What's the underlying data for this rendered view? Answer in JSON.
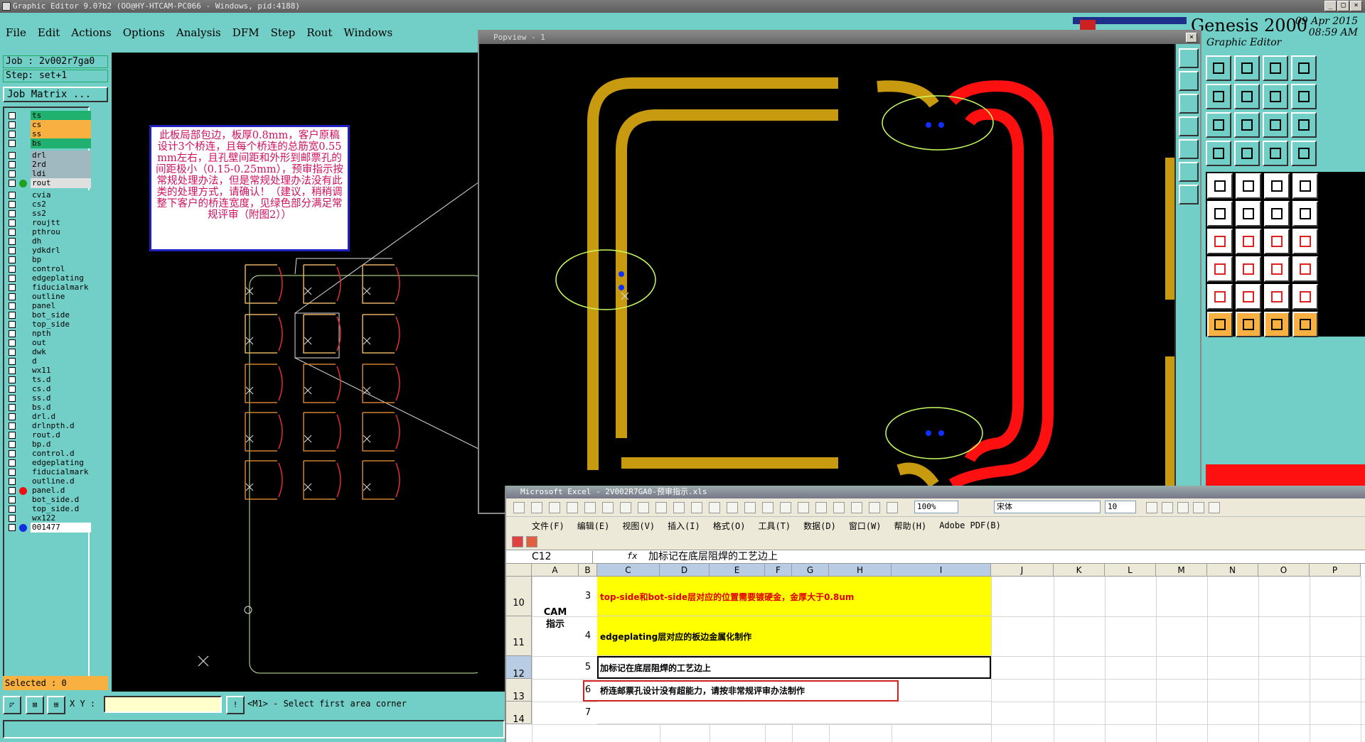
{
  "window": {
    "title": "Graphic Editor 9.0?b2 (OO@HY-HTCAM-PC066 - Windows, pid:4188)"
  },
  "menu": [
    "File",
    "Edit",
    "Actions",
    "Options",
    "Analysis",
    "DFM",
    "Step",
    "Rout",
    "Windows"
  ],
  "genesis": {
    "title": "Genesis 2000",
    "subtitle": "Graphic Editor",
    "date": "09 Apr 2015",
    "time": "08:59 AM"
  },
  "job": {
    "job_label": "Job : 2v002r7ga0",
    "step_label": "Step: set+1",
    "matrix_button": "Job Matrix ..."
  },
  "layers": [
    {
      "name": "ts",
      "color": "#20b070"
    },
    {
      "name": "cs",
      "color": "#f8b040"
    },
    {
      "name": "ss",
      "color": "#f8b040"
    },
    {
      "name": "bs",
      "color": "#20b070"
    },
    {
      "name": "drl",
      "color": "#a0b8c0"
    },
    {
      "name": "2rd",
      "color": "#a0b8c0"
    },
    {
      "name": "ldi",
      "color": "#a0b8c0"
    },
    {
      "name": "rout",
      "color": "#e0e0e0",
      "dot": "#20a020"
    },
    {
      "name": "cvia",
      "color": ""
    },
    {
      "name": "cs2",
      "color": ""
    },
    {
      "name": "ss2",
      "color": ""
    },
    {
      "name": "roujtt",
      "color": ""
    },
    {
      "name": "pthrou",
      "color": ""
    },
    {
      "name": "dh",
      "color": ""
    },
    {
      "name": "ydkdrl",
      "color": ""
    },
    {
      "name": "bp",
      "color": ""
    },
    {
      "name": "control",
      "color": ""
    },
    {
      "name": "edgeplating",
      "color": ""
    },
    {
      "name": "fiducialmark",
      "color": ""
    },
    {
      "name": "outline",
      "color": ""
    },
    {
      "name": "panel",
      "color": ""
    },
    {
      "name": "bot_side",
      "color": ""
    },
    {
      "name": "top_side",
      "color": ""
    },
    {
      "name": "npth",
      "color": ""
    },
    {
      "name": "out",
      "color": ""
    },
    {
      "name": "dwk",
      "color": ""
    },
    {
      "name": "d",
      "color": ""
    },
    {
      "name": "wx11",
      "color": ""
    },
    {
      "name": "ts.d",
      "color": ""
    },
    {
      "name": "cs.d",
      "color": ""
    },
    {
      "name": "ss.d",
      "color": ""
    },
    {
      "name": "bs.d",
      "color": ""
    },
    {
      "name": "drl.d",
      "color": ""
    },
    {
      "name": "drlnpth.d",
      "color": ""
    },
    {
      "name": "rout.d",
      "color": ""
    },
    {
      "name": "bp.d",
      "color": ""
    },
    {
      "name": "control.d",
      "color": ""
    },
    {
      "name": "edgeplating",
      "color": ""
    },
    {
      "name": "fiducialmark",
      "color": ""
    },
    {
      "name": "outline.d",
      "color": ""
    },
    {
      "name": "panel.d",
      "color": "",
      "dot": "#ee1010"
    },
    {
      "name": "bot_side.d",
      "color": ""
    },
    {
      "name": "top_side.d",
      "color": ""
    },
    {
      "name": "wx122",
      "color": ""
    },
    {
      "name": "001477",
      "color": "#ffffff",
      "dot": "#1030e0"
    }
  ],
  "note": {
    "text": "此板局部包边，板厚0.8mm，客户原稿设计3个桥连，且每个桥连的总筋宽0.55mm左右，且孔壁间距和外形到邮票孔的间距极小（0.15-0.25mm），预审指示按常规处理办法，但是常规处理办法没有此类的处理方式，请确认！（建议，稍稍调整下客户的桥连宽度，见绿色部分满足常规评审（附图2））"
  },
  "popview": {
    "title": "Popview - 1"
  },
  "bottom": {
    "selected": "Selected : 0",
    "xy_label": "X Y :",
    "prompt": "<M1> - Select first area corner"
  },
  "excel": {
    "title": "Microsoft Excel - 2V002R7GA0-预审指示.xls",
    "zoom": "100%",
    "font": "宋体",
    "font_size": "10",
    "menu": [
      "文件(F)",
      "编辑(E)",
      "视图(V)",
      "插入(I)",
      "格式(O)",
      "工具(T)",
      "数据(D)",
      "窗口(W)",
      "帮助(H)",
      "Adobe PDF(B)"
    ],
    "name_box": "C12",
    "fx_label": "fx",
    "formula": "加标记在底层阻焊的工艺边上",
    "columns": [
      "A",
      "B",
      "C",
      "D",
      "E",
      "F",
      "G",
      "H",
      "I",
      "J",
      "K",
      "L",
      "M",
      "N",
      "O",
      "P"
    ],
    "rows": [
      "10",
      "11",
      "12",
      "13",
      "14"
    ],
    "cam_label": "CAM\n指示",
    "items": [
      {
        "no": "3",
        "text": "top-side和bot-side层对应的位置需要镀硬金，金厚大于0.8um",
        "color": "#e00000",
        "bg": "#ffff00"
      },
      {
        "no": "4",
        "text": "edgeplating层对应的板边金属化制作",
        "color": "#000000",
        "bg": "#ffff00"
      },
      {
        "no": "5",
        "text": "加标记在底层阻焊的工艺边上",
        "color": "#000000",
        "bg": "#ffffff"
      },
      {
        "no": "6",
        "text": "桥连邮票孔设计没有超能力，请按非常规评审办法制作",
        "color": "#000000",
        "bg": "#ffffff"
      },
      {
        "no": "7",
        "text": "",
        "color": "#000000",
        "bg": "#ffffff"
      }
    ]
  }
}
